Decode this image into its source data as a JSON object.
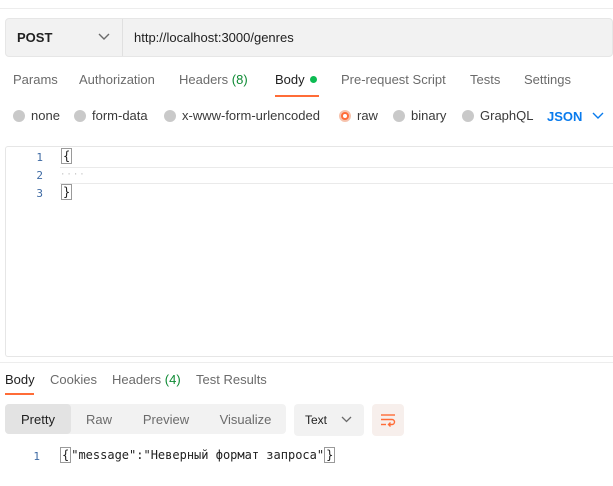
{
  "request": {
    "method": "POST",
    "url": "http://localhost:3000/genres"
  },
  "request_tabs": {
    "params": "Params",
    "authorization": "Authorization",
    "headers": "Headers",
    "headers_count": "(8)",
    "body": "Body",
    "pre_request": "Pre-request Script",
    "tests": "Tests",
    "settings": "Settings",
    "active": "Body"
  },
  "body_types": {
    "none": "none",
    "form_data": "form-data",
    "urlencoded": "x-www-form-urlencoded",
    "raw": "raw",
    "binary": "binary",
    "graphql": "GraphQL",
    "selected": "raw",
    "language": "JSON"
  },
  "editor": {
    "line_numbers": [
      "1",
      "2",
      "3"
    ],
    "lines": [
      "{",
      "",
      "}"
    ]
  },
  "response_tabs": {
    "body": "Body",
    "cookies": "Cookies",
    "headers": "Headers",
    "headers_count": "(4)",
    "test_results": "Test Results",
    "active": "Body"
  },
  "response_view": {
    "pretty": "Pretty",
    "raw": "Raw",
    "preview": "Preview",
    "visualize": "Visualize",
    "active": "Pretty",
    "format": "Text"
  },
  "response_body": {
    "line_number": "1",
    "text": "\"message\":\"Неверный формат запроса\"",
    "open_brace": "{",
    "close_brace": "}"
  },
  "colors": {
    "accent": "#ff6c37",
    "active_dot": "#0cbb52",
    "count": "#0e8a34",
    "json_link": "#097bed"
  }
}
